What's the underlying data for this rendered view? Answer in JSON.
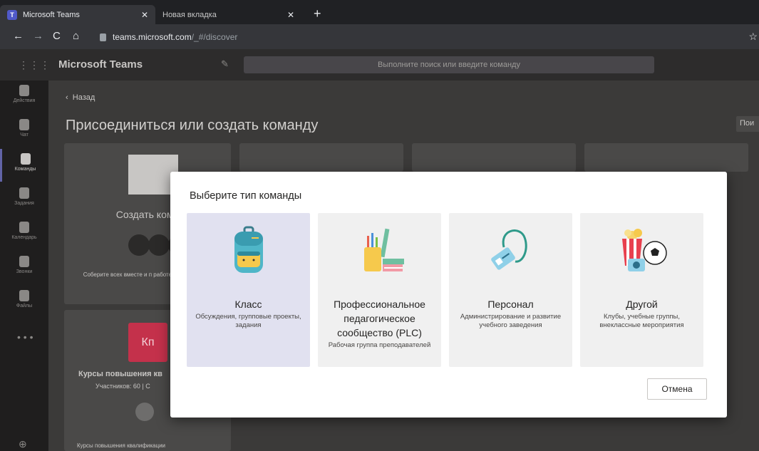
{
  "browser": {
    "tabs": [
      {
        "label": "Microsoft Teams",
        "close": "✕"
      },
      {
        "label": "Новая вкладка",
        "close": "✕"
      }
    ],
    "new_tab": "+",
    "url_host": "teams.microsoft.com",
    "url_path": "/_#/discover"
  },
  "teams": {
    "app_name": "Microsoft Teams",
    "search_placeholder": "Выполните поиск или введите команду",
    "rail": [
      {
        "label": "Действия",
        "icon": "bell-icon"
      },
      {
        "label": "Чат",
        "icon": "chat-icon"
      },
      {
        "label": "Команды",
        "icon": "teams-icon"
      },
      {
        "label": "Задания",
        "icon": "assignments-icon"
      },
      {
        "label": "Календарь",
        "icon": "calendar-icon"
      },
      {
        "label": "Звонки",
        "icon": "phone-icon"
      },
      {
        "label": "Файлы",
        "icon": "files-icon"
      }
    ],
    "rail_more": "• • •",
    "back_label": "Назад",
    "page_title": "Присоединиться или создать команду",
    "search_partial": "Пои",
    "create_card": {
      "title": "Создать кома",
      "desc": "Соберите всех вместе и п работе!"
    },
    "team_card": {
      "initials": "Кп",
      "name": "Курсы повышения кв",
      "members": "Участников: 60 | С",
      "footer": "Курсы повышения квалификации"
    }
  },
  "modal": {
    "title": "Выберите тип команды",
    "options": [
      {
        "title": "Класс",
        "desc": "Обсуждения, групповые проекты, задания",
        "icon": "backpack-icon"
      },
      {
        "title": "Профессиональное педагогическое сообщество (PLC)",
        "desc": "Рабочая группа преподавателей",
        "icon": "books-icon"
      },
      {
        "title": "Персонал",
        "desc": "Администрирование и развитие учебного заведения",
        "icon": "badge-icon"
      },
      {
        "title": "Другой",
        "desc": "Клубы, учебные группы, внеклассные мероприятия",
        "icon": "popcorn-ball-icon"
      }
    ],
    "cancel_label": "Отмена"
  },
  "colors": {
    "accent": "#6264a7",
    "team_tile": "#c4314b"
  }
}
